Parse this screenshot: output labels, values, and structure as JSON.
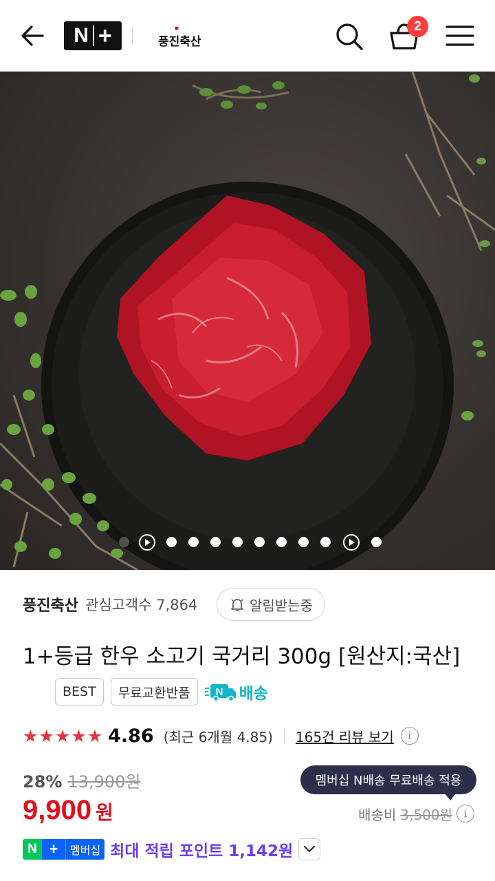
{
  "header": {
    "badge_n": "N",
    "badge_plus": "+",
    "store_logo_text": "풍진축산",
    "cart_count": "2"
  },
  "gallery": {
    "total_slides": 12,
    "active_index": 0
  },
  "store": {
    "name": "풍진축산",
    "interest_label": "관심고객수 7,864",
    "alarm_button": "알림받는중"
  },
  "product": {
    "title": "1+등급 한우 소고기 국거리 300g [원산지:국산]",
    "tags": [
      "BEST",
      "무료교환반품"
    ],
    "delivery_label": "배송",
    "delivery_icon_letter": "N"
  },
  "rating": {
    "stars": 5,
    "score": "4.86",
    "recent": "(최근 6개월 4.85)",
    "review_link": "165건 리뷰 보기",
    "info_icon": "i"
  },
  "pricing": {
    "discount_rate": "28%",
    "original_price": "13,900원",
    "price": "9,900",
    "price_unit": "원",
    "tooltip": "멤버십 N배송 무료배송 적용",
    "shipping_label": "배송비",
    "shipping_fee": "3,500원"
  },
  "points": {
    "badge_n": "N",
    "badge_plus": "+",
    "badge_member": "멤버십",
    "text": "최대 적립 포인트 1,142원"
  },
  "colors": {
    "price_red": "#e0111c",
    "star_red": "#e3323b",
    "tooltip_navy": "#2b2f4a",
    "points_purple": "#6b3df0",
    "delivery_teal": "#14b5c9",
    "badge_red": "#ff3d3d"
  },
  "icons": {
    "back": "arrow-left-icon",
    "search": "search-icon",
    "cart": "shopping-bag-icon",
    "menu": "hamburger-menu-icon",
    "expand": "expand-diagonal-icon",
    "bell": "bell-icon",
    "chevron": "chevron-down-icon"
  }
}
